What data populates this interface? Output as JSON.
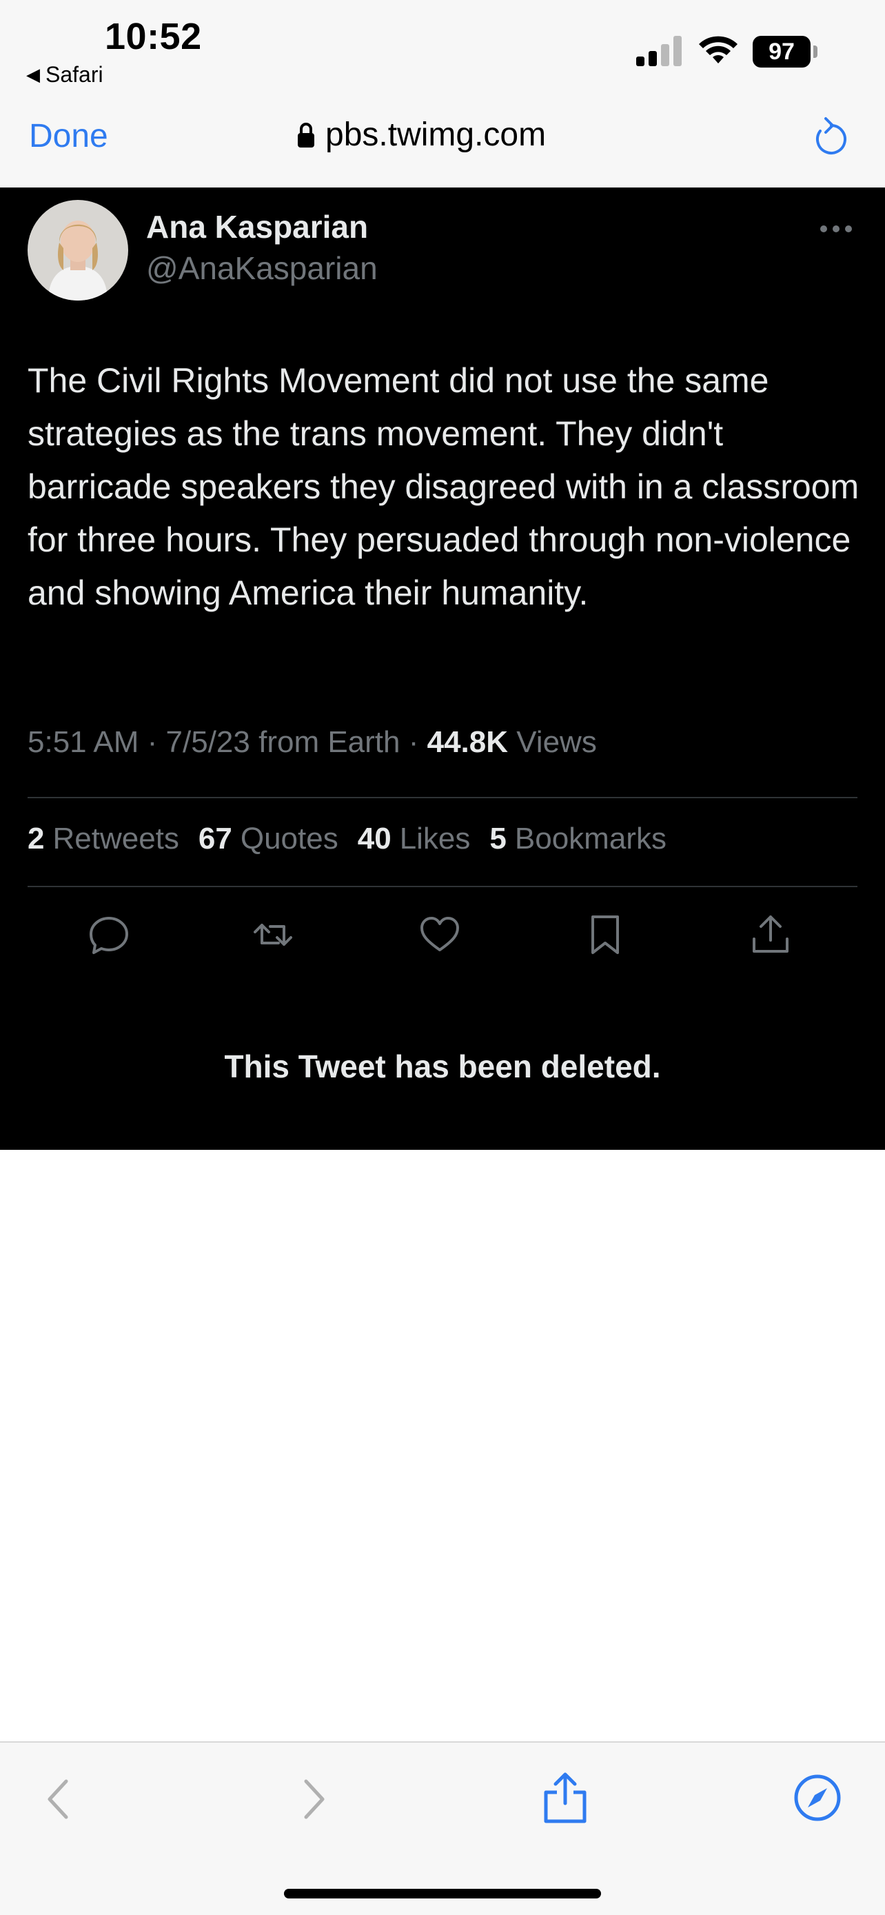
{
  "status_bar": {
    "time": "10:52",
    "back_app": "Safari",
    "battery": "97"
  },
  "nav": {
    "done_label": "Done",
    "url": "pbs.twimg.com"
  },
  "tweet": {
    "author_name": "Ana Kasparian",
    "author_handle": "@AnaKasparian",
    "text": "The Civil Rights Movement did not use the same strategies as the trans movement. They didn't barricade speakers they disagreed with in a classroom for three hours. They persuaded through non-violence and showing America their humanity.",
    "timestamp": "5:51 AM · 7/5/23 from Earth · ",
    "views_count": "44.8K",
    "views_label": " Views",
    "stats": [
      {
        "count": "2",
        "label": "Retweets"
      },
      {
        "count": "67",
        "label": "Quotes"
      },
      {
        "count": "40",
        "label": "Likes"
      },
      {
        "count": "5",
        "label": "Bookmarks"
      }
    ],
    "deleted_notice": "This Tweet has been deleted.",
    "icons": {
      "reply": "reply-icon",
      "retweet": "retweet-icon",
      "like": "heart-icon",
      "bookmark": "bookmark-icon",
      "share": "share-icon",
      "more": "more-icon"
    }
  },
  "colors": {
    "accent": "#2f7bf0",
    "tweet_bg": "#000000",
    "muted": "#71767b",
    "text": "#e7e9ea"
  }
}
